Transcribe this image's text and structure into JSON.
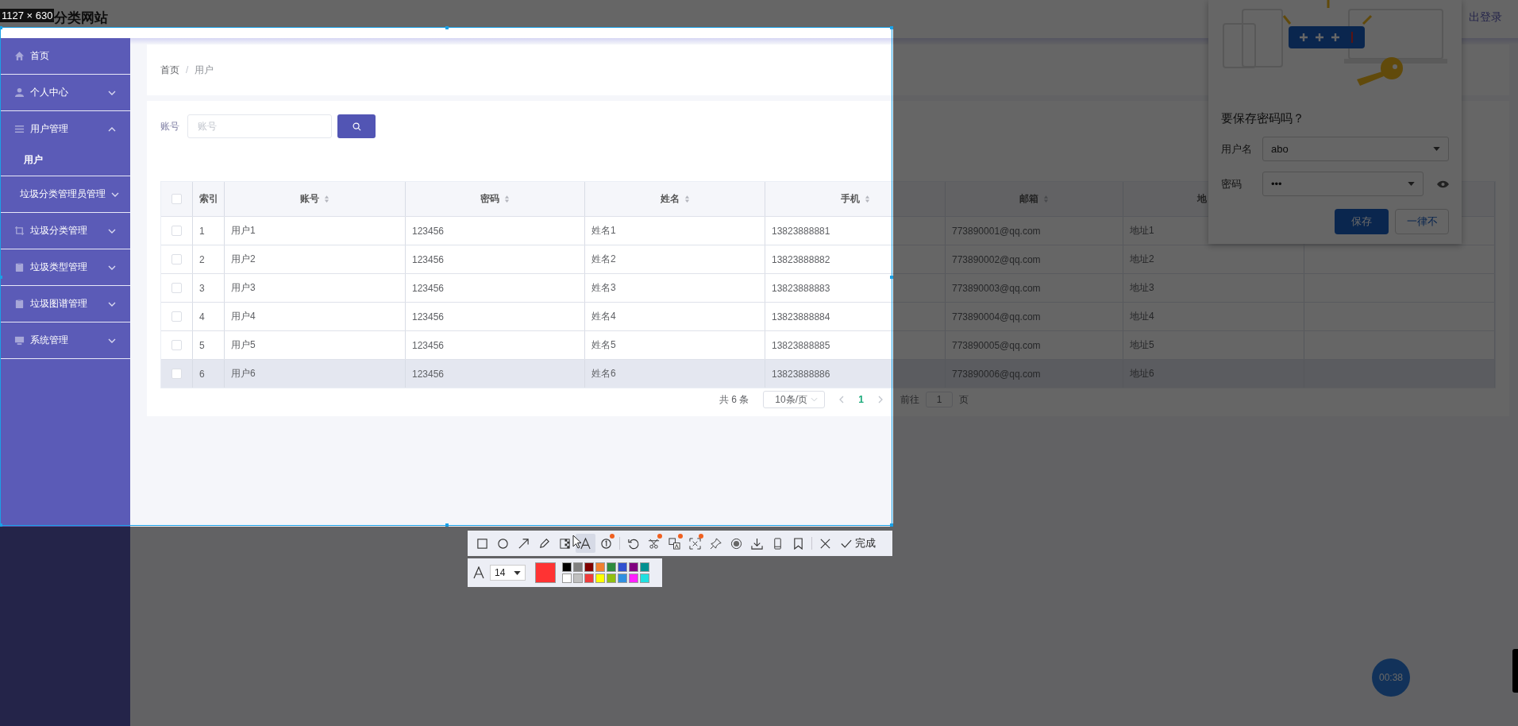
{
  "header": {
    "title": "分类网站",
    "logout": "出登录"
  },
  "sidebar": {
    "items": [
      {
        "label": "首页"
      },
      {
        "label": "个人中心",
        "expanded": false
      },
      {
        "label": "用户管理",
        "expanded": true,
        "children": [
          {
            "label": "用户"
          }
        ]
      },
      {
        "label": "垃圾分类管理员管理",
        "expanded": false
      },
      {
        "label": "垃圾分类管理",
        "expanded": false
      },
      {
        "label": "垃圾类型管理",
        "expanded": false
      },
      {
        "label": "垃圾图谱管理",
        "expanded": false
      },
      {
        "label": "系统管理",
        "expanded": false
      }
    ]
  },
  "breadcrumb": {
    "items": [
      "首页",
      "用户"
    ],
    "separator": "/"
  },
  "search": {
    "label": "账号",
    "placeholder": "账号"
  },
  "table": {
    "select_all_checked": false,
    "columns": [
      {
        "label": "索引",
        "sortable": false
      },
      {
        "label": "账号",
        "sortable": true
      },
      {
        "label": "密码",
        "sortable": true
      },
      {
        "label": "姓名",
        "sortable": true
      },
      {
        "label": "手机",
        "sortable": true
      },
      {
        "label": "邮箱",
        "sortable": true
      },
      {
        "label": "地",
        "sortable": false
      }
    ],
    "rows": [
      {
        "checked": false,
        "hovered": false,
        "cells": [
          "1",
          "用户1",
          "123456",
          "姓名1",
          "13823888881",
          "773890001@qq.com",
          "地址1"
        ]
      },
      {
        "checked": false,
        "hovered": false,
        "cells": [
          "2",
          "用户2",
          "123456",
          "姓名2",
          "13823888882",
          "773890002@qq.com",
          "地址2"
        ]
      },
      {
        "checked": false,
        "hovered": false,
        "cells": [
          "3",
          "用户3",
          "123456",
          "姓名3",
          "13823888883",
          "773890003@qq.com",
          "地址3"
        ]
      },
      {
        "checked": false,
        "hovered": false,
        "cells": [
          "4",
          "用户4",
          "123456",
          "姓名4",
          "13823888884",
          "773890004@qq.com",
          "地址4"
        ]
      },
      {
        "checked": false,
        "hovered": false,
        "cells": [
          "5",
          "用户5",
          "123456",
          "姓名5",
          "13823888885",
          "773890005@qq.com",
          "地址5"
        ]
      },
      {
        "checked": false,
        "hovered": true,
        "cells": [
          "6",
          "用户6",
          "123456",
          "姓名6",
          "13823888886",
          "773890006@qq.com",
          "地址6"
        ]
      }
    ]
  },
  "pagination": {
    "total": "共 6 条",
    "page_size": "10条/页",
    "pages": [
      {
        "label": "1",
        "selected": true
      }
    ],
    "goto_label": "前往",
    "goto_value": "1",
    "goto_suffix": "页"
  },
  "password_popup": {
    "title": "要保存密码吗？",
    "username_label": "用户名",
    "username": "abo",
    "password_label": "密码",
    "password": "•••",
    "save": "保存",
    "never": "一律不"
  },
  "screenshot_tool": {
    "size_label": "1127 × 630",
    "tool_groups": [
      [
        {
          "kind": "rect",
          "selected": false,
          "badge": false
        },
        {
          "kind": "ellipse",
          "selected": false,
          "badge": false
        },
        {
          "kind": "arrow",
          "selected": false,
          "badge": false
        },
        {
          "kind": "pencil",
          "selected": false,
          "badge": false
        },
        {
          "kind": "mosaic",
          "selected": false,
          "badge": false
        },
        {
          "kind": "text",
          "selected": true,
          "badge": false
        },
        {
          "kind": "number",
          "selected": false,
          "badge": true
        }
      ],
      [
        {
          "kind": "undo",
          "selected": false,
          "badge": false
        },
        {
          "kind": "scissors",
          "selected": false,
          "badge": true
        },
        {
          "kind": "translate",
          "selected": false,
          "badge": true
        },
        {
          "kind": "scan",
          "selected": false,
          "badge": true
        },
        {
          "kind": "pin",
          "selected": false,
          "badge": false
        },
        {
          "kind": "record",
          "selected": false,
          "badge": false
        },
        {
          "kind": "download",
          "selected": false,
          "badge": false
        },
        {
          "kind": "phone",
          "selected": false,
          "badge": false
        },
        {
          "kind": "bookmark",
          "selected": false,
          "badge": false
        }
      ],
      [
        {
          "kind": "close",
          "selected": false,
          "badge": false
        }
      ]
    ],
    "done": "完成",
    "font_size": "14",
    "current": {
      "color": "#ff3333"
    },
    "palette": [
      {
        "color": "#000000"
      },
      {
        "color": "#808080"
      },
      {
        "color": "#800000"
      },
      {
        "color": "#f08030"
      },
      {
        "color": "#2e8b3e"
      },
      {
        "color": "#3050d0"
      },
      {
        "color": "#800080"
      },
      {
        "color": "#009090"
      },
      {
        "color": "#ffffff"
      },
      {
        "color": "#c0c0c0"
      },
      {
        "color": "#f03c3c"
      },
      {
        "color": "#ffff00"
      },
      {
        "color": "#90c010"
      },
      {
        "color": "#3090e0"
      },
      {
        "color": "#ff20ff"
      },
      {
        "color": "#20e0e0"
      }
    ],
    "timer": "00:38"
  }
}
